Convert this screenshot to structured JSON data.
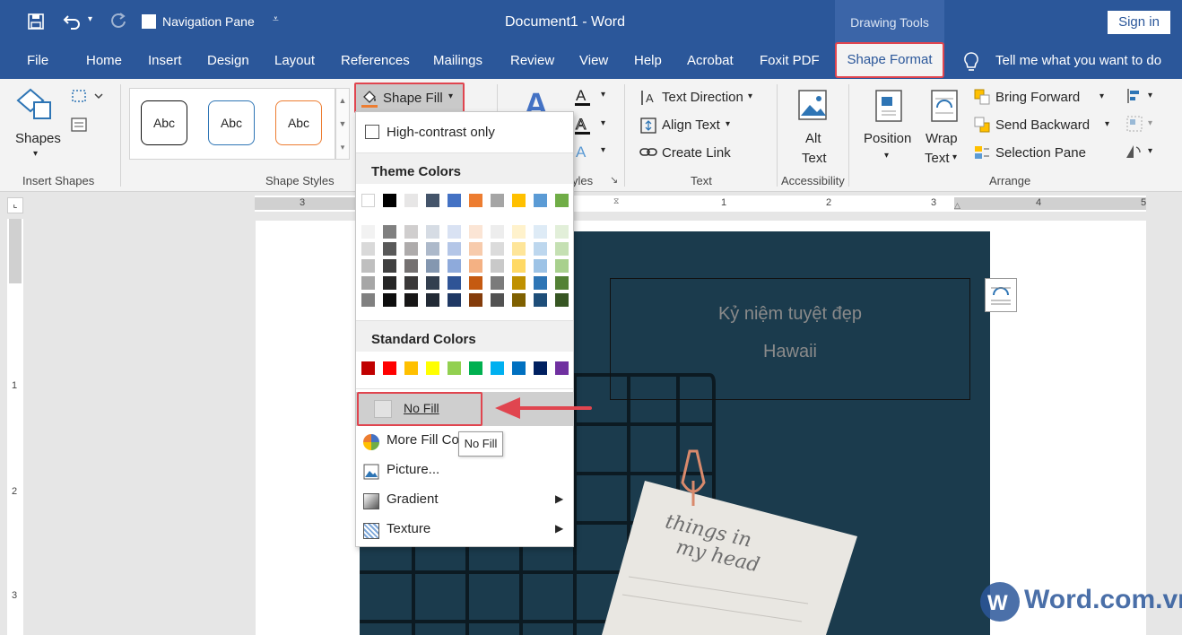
{
  "titlebar": {
    "nav_pane": "Navigation Pane",
    "document_title": "Document1  -  Word",
    "context_group": "Drawing Tools",
    "sign_in": "Sign in"
  },
  "tabs": [
    "File",
    "Home",
    "Insert",
    "Design",
    "Layout",
    "References",
    "Mailings",
    "Review",
    "View",
    "Help",
    "Acrobat",
    "Foxit PDF"
  ],
  "active_tab": "Shape Format",
  "tell_me": "Tell me what you want to do",
  "ribbon": {
    "insert_shapes": {
      "shapes": "Shapes",
      "label": "Insert Shapes"
    },
    "shape_styles": {
      "preset1": "Abc",
      "preset2": "Abc",
      "preset3": "Abc",
      "shape_fill": "Shape Fill",
      "label": "Shape Styles"
    },
    "wordart": {
      "label": "yles"
    },
    "text": {
      "text_direction": "Text Direction",
      "align_text": "Align Text",
      "create_link": "Create Link",
      "label": "Text"
    },
    "accessibility": {
      "alt_text_1": "Alt",
      "alt_text_2": "Text",
      "label": "Accessibility"
    },
    "arrange": {
      "position": "Position",
      "wrap_1": "Wrap",
      "wrap_2": "Text",
      "bring_forward": "Bring Forward",
      "send_backward": "Send Backward",
      "selection_pane": "Selection Pane",
      "label": "Arrange"
    }
  },
  "ruler_marks": [
    "3",
    "1",
    "2",
    "3",
    "4",
    "5"
  ],
  "vruler_marks": [
    "1",
    "2",
    "3"
  ],
  "dropdown": {
    "high_contrast": "High-contrast only",
    "theme_colors": "Theme Colors",
    "standard_colors": "Standard Colors",
    "no_fill": "No Fill",
    "more_fill": "More Fill Co",
    "tooltip": "No Fill",
    "picture": "Picture...",
    "gradient": "Gradient",
    "texture": "Texture"
  },
  "theme_top": [
    "#ffffff",
    "#000000",
    "#e7e6e6",
    "#44546a",
    "#4472c4",
    "#ed7d31",
    "#a5a5a5",
    "#ffc000",
    "#5b9bd5",
    "#70ad47"
  ],
  "theme_shades": [
    [
      "#f2f2f2",
      "#d9d9d9",
      "#bfbfbf",
      "#a6a6a6",
      "#808080"
    ],
    [
      "#808080",
      "#595959",
      "#404040",
      "#262626",
      "#0d0d0d"
    ],
    [
      "#d0cece",
      "#aeabab",
      "#757171",
      "#3a3838",
      "#171616"
    ],
    [
      "#d6dce4",
      "#adb9ca",
      "#8497b0",
      "#333f4f",
      "#222a35"
    ],
    [
      "#d9e2f3",
      "#b4c6e7",
      "#8eaadb",
      "#2f5496",
      "#1f3864"
    ],
    [
      "#fbe5d5",
      "#f7cbac",
      "#f4b183",
      "#c55a11",
      "#843c0b"
    ],
    [
      "#ededed",
      "#dbdbdb",
      "#c9c9c9",
      "#7b7b7b",
      "#525252"
    ],
    [
      "#fff2cc",
      "#fee599",
      "#ffd965",
      "#bf9000",
      "#7f6000"
    ],
    [
      "#deebf6",
      "#bdd7ee",
      "#9dc3e6",
      "#2e75b5",
      "#1e4e79"
    ],
    [
      "#e2efd9",
      "#c5e0b3",
      "#a8d08d",
      "#538135",
      "#375623"
    ]
  ],
  "standard": [
    "#c00000",
    "#ff0000",
    "#ffc000",
    "#ffff00",
    "#92d050",
    "#00b050",
    "#00b0f0",
    "#0070c0",
    "#002060",
    "#7030a0"
  ],
  "document": {
    "line1": "Kỷ niệm tuyệt đẹp",
    "line2": "Hawaii",
    "note_line1": "things  in",
    "note_line2": "my  head"
  },
  "watermark": {
    "text": "Word.com.vn"
  },
  "colors": {
    "word_blue": "#2b579a",
    "highlight_red": "#e0454f",
    "photo_bg": "#1b3b4d"
  }
}
